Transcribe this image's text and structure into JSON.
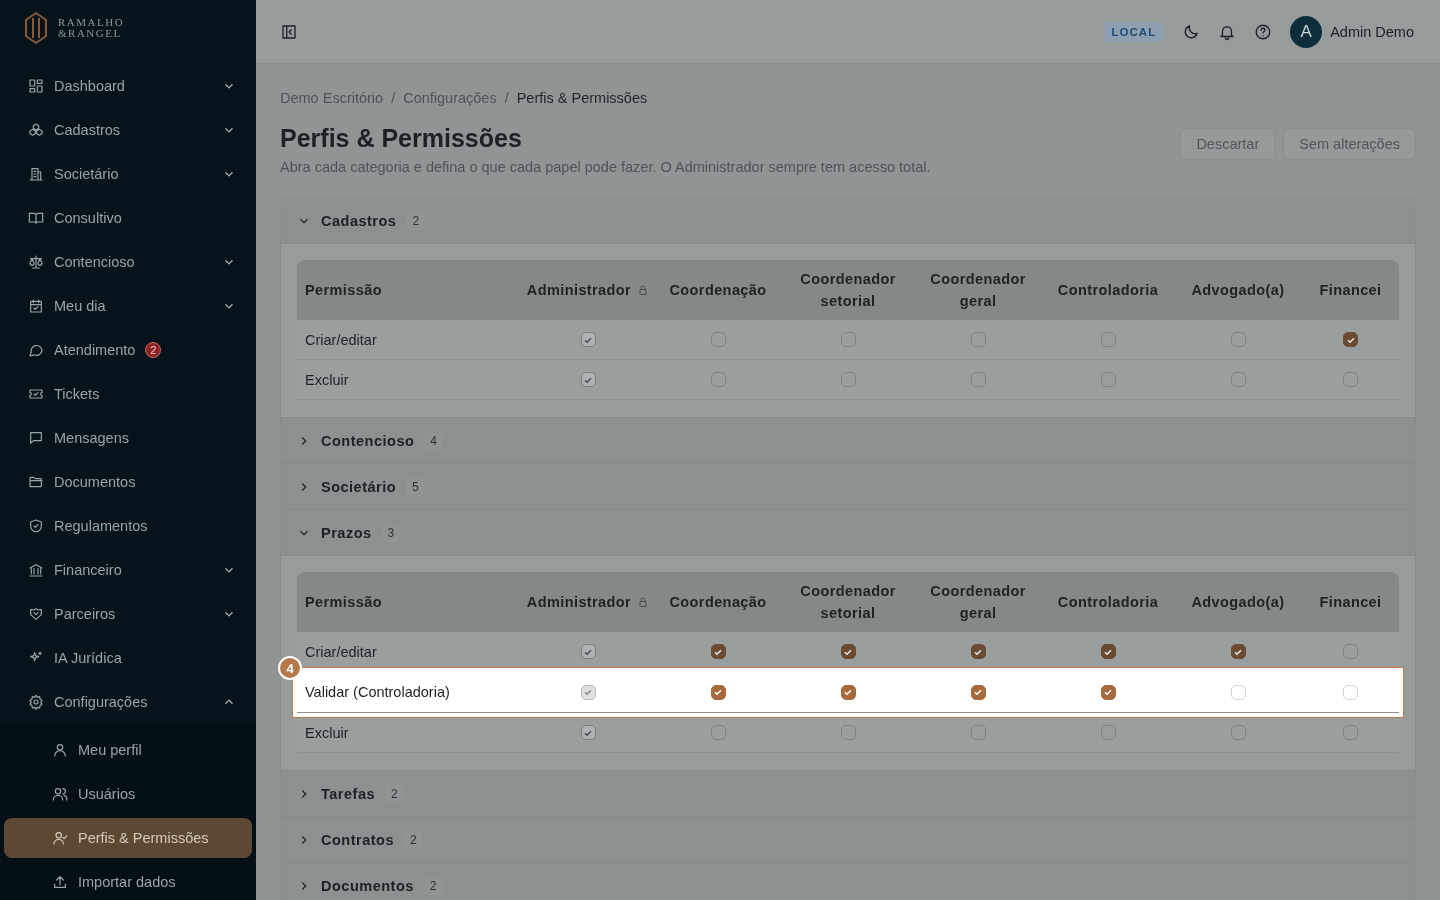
{
  "brand": {
    "line_1": "RAMALHO",
    "line_2": "&RANGEL"
  },
  "sidebar": {
    "items": [
      {
        "label": "Dashboard",
        "expandable": true,
        "expanded": false,
        "selected": false
      },
      {
        "label": "Cadastros",
        "expandable": true,
        "expanded": false,
        "selected": false
      },
      {
        "label": "Societário",
        "expandable": true,
        "expanded": false,
        "selected": false
      },
      {
        "label": "Consultivo",
        "expandable": false,
        "selected": false
      },
      {
        "label": "Contencioso",
        "expandable": true,
        "expanded": false,
        "selected": false
      },
      {
        "label": "Meu dia",
        "expandable": true,
        "expanded": false,
        "selected": false
      },
      {
        "label": "Atendimento",
        "expandable": false,
        "badge": "2",
        "selected": false
      },
      {
        "label": "Tickets",
        "expandable": false,
        "selected": false
      },
      {
        "label": "Mensagens",
        "expandable": false,
        "selected": false
      },
      {
        "label": "Documentos",
        "expandable": false,
        "selected": false
      },
      {
        "label": "Regulamentos",
        "expandable": false,
        "selected": false
      },
      {
        "label": "Financeiro",
        "expandable": true,
        "expanded": false,
        "selected": false
      },
      {
        "label": "Parceiros",
        "expandable": true,
        "expanded": false,
        "selected": false
      },
      {
        "label": "IA Jurídica",
        "expandable": false,
        "selected": false
      },
      {
        "label": "Configurações",
        "expandable": true,
        "expanded": true,
        "selected": false,
        "children": [
          {
            "label": "Meu perfil",
            "selected": false
          },
          {
            "label": "Usuários",
            "selected": false
          },
          {
            "label": "Perfis & Permissões",
            "selected": true
          },
          {
            "label": "Importar dados",
            "selected": false
          }
        ]
      }
    ]
  },
  "topbar": {
    "env_badge": "LOCAL",
    "user": {
      "initial": "A",
      "name": "Admin Demo"
    }
  },
  "breadcrumb": {
    "items": [
      {
        "label": "Demo Escritório",
        "current": false
      },
      {
        "label": "Configurações",
        "current": false
      },
      {
        "label": "Perfis & Permissões",
        "current": true
      }
    ],
    "separators": [
      "/",
      "/"
    ]
  },
  "page": {
    "title": "Perfis & Permissões",
    "subtitle": "Abra cada categoria e defina o que cada papel pode fazer. O Administrador sempre tem acesso total.",
    "buttons": [
      {
        "label": "Descartar",
        "disabled": true
      },
      {
        "label": "Sem alterações",
        "disabled": true
      }
    ]
  },
  "categories": [
    {
      "name": "Cadastros",
      "count": "2",
      "expanded": true,
      "table": {
        "columns": [
          {
            "label": "Permissão",
            "locked": false
          },
          {
            "label": "Administrador",
            "locked": true
          },
          {
            "label": "Coordenação",
            "locked": false
          },
          {
            "label": "Coordenador setorial",
            "locked": false
          },
          {
            "label": "Coordenador geral",
            "locked": false
          },
          {
            "label": "Controladoria",
            "locked": false
          },
          {
            "label": "Advogado(a)",
            "locked": false
          },
          {
            "label": "Financei",
            "locked": false
          }
        ],
        "rows": [
          {
            "label": "Criar/editar",
            "highlighted": false,
            "cells": [
              {
                "checked": true,
                "disabled": true
              },
              {
                "checked": false,
                "disabled": false
              },
              {
                "checked": false,
                "disabled": false
              },
              {
                "checked": false,
                "disabled": false
              },
              {
                "checked": false,
                "disabled": false
              },
              {
                "checked": false,
                "disabled": false
              },
              {
                "checked": true,
                "disabled": false
              }
            ]
          },
          {
            "label": "Excluir",
            "highlighted": false,
            "cells": [
              {
                "checked": true,
                "disabled": true
              },
              {
                "checked": false,
                "disabled": false
              },
              {
                "checked": false,
                "disabled": false
              },
              {
                "checked": false,
                "disabled": false
              },
              {
                "checked": false,
                "disabled": false
              },
              {
                "checked": false,
                "disabled": false
              },
              {
                "checked": false,
                "disabled": false
              }
            ]
          }
        ]
      }
    },
    {
      "name": "Contencioso",
      "count": "4",
      "expanded": false
    },
    {
      "name": "Societário",
      "count": "5",
      "expanded": false
    },
    {
      "name": "Prazos",
      "count": "3",
      "expanded": true,
      "table": {
        "columns": [
          {
            "label": "Permissão",
            "locked": false
          },
          {
            "label": "Administrador",
            "locked": true
          },
          {
            "label": "Coordenação",
            "locked": false
          },
          {
            "label": "Coordenador setorial",
            "locked": false
          },
          {
            "label": "Coordenador geral",
            "locked": false
          },
          {
            "label": "Controladoria",
            "locked": false
          },
          {
            "label": "Advogado(a)",
            "locked": false
          },
          {
            "label": "Financei",
            "locked": false
          }
        ],
        "rows": [
          {
            "label": "Criar/editar",
            "highlighted": false,
            "cells": [
              {
                "checked": true,
                "disabled": true
              },
              {
                "checked": true,
                "disabled": false
              },
              {
                "checked": true,
                "disabled": false
              },
              {
                "checked": true,
                "disabled": false
              },
              {
                "checked": true,
                "disabled": false
              },
              {
                "checked": true,
                "disabled": false
              },
              {
                "checked": false,
                "disabled": false
              }
            ]
          },
          {
            "label": "Validar (Controladoria)",
            "highlighted": true,
            "tour_step": "4",
            "cells": [
              {
                "checked": true,
                "disabled": true
              },
              {
                "checked": true,
                "disabled": false
              },
              {
                "checked": true,
                "disabled": false
              },
              {
                "checked": true,
                "disabled": false
              },
              {
                "checked": true,
                "disabled": false
              },
              {
                "checked": false,
                "disabled": false
              },
              {
                "checked": false,
                "disabled": false
              }
            ]
          },
          {
            "label": "Excluir",
            "highlighted": false,
            "cells": [
              {
                "checked": true,
                "disabled": true
              },
              {
                "checked": false,
                "disabled": false
              },
              {
                "checked": false,
                "disabled": false
              },
              {
                "checked": false,
                "disabled": false
              },
              {
                "checked": false,
                "disabled": false
              },
              {
                "checked": false,
                "disabled": false
              },
              {
                "checked": false,
                "disabled": false
              }
            ]
          }
        ]
      }
    },
    {
      "name": "Tarefas",
      "count": "2",
      "expanded": false
    },
    {
      "name": "Contratos",
      "count": "2",
      "expanded": false
    },
    {
      "name": "Documentos",
      "count": "2",
      "expanded": false
    }
  ]
}
